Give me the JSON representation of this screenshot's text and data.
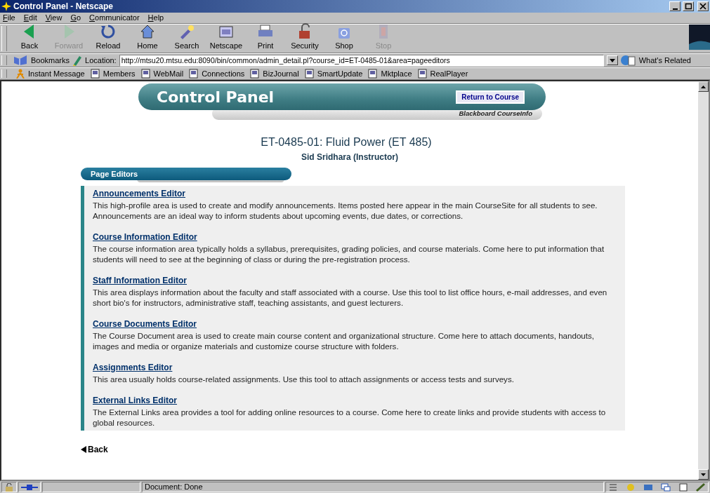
{
  "window": {
    "title": "Control Panel - Netscape"
  },
  "menu": [
    "File",
    "Edit",
    "View",
    "Go",
    "Communicator",
    "Help"
  ],
  "toolbar": [
    {
      "label": "Back",
      "disabled": false
    },
    {
      "label": "Forward",
      "disabled": true
    },
    {
      "label": "Reload",
      "disabled": false
    },
    {
      "label": "Home",
      "disabled": false
    },
    {
      "label": "Search",
      "disabled": false
    },
    {
      "label": "Netscape",
      "disabled": false
    },
    {
      "label": "Print",
      "disabled": false
    },
    {
      "label": "Security",
      "disabled": false
    },
    {
      "label": "Shop",
      "disabled": false
    },
    {
      "label": "Stop",
      "disabled": true
    }
  ],
  "location_bar": {
    "bookmarks": "Bookmarks",
    "label": "Location:",
    "url": "http://mtsu20.mtsu.edu:8090/bin/common/admin_detail.pl?course_id=ET-0485-01&area=pageeditors",
    "related": "What's Related"
  },
  "personal_bar": [
    "Instant Message",
    "Members",
    "WebMail",
    "Connections",
    "BizJournal",
    "SmartUpdate",
    "Mktplace",
    "RealPlayer"
  ],
  "page": {
    "banner_title": "Control Panel",
    "return_button": "Return to Course",
    "brand": "Blackboard CourseInfo",
    "course_title": "ET-0485-01: Fluid Power (ET 485)",
    "instructor": "Sid Sridhara (Instructor)",
    "section_title": "Page Editors",
    "editors": [
      {
        "title": "Announcements Editor",
        "description": "This high-profile area is used to create and modify announcements. Items posted here appear in the main CourseSite for all students to see. Announcements are an ideal way to inform students about upcoming events, due dates, or corrections."
      },
      {
        "title": "Course Information Editor",
        "description": "The course information area typically holds a syllabus, prerequisites, grading policies, and course materials. Come here to put information that students will need to see at the beginning of class or during the pre-registration process."
      },
      {
        "title": "Staff Information Editor",
        "description": "This area displays information about the faculty and staff associated with a course. Use this tool to list office hours, e-mail addresses, and even short bio's for instructors, administrative staff, teaching assistants, and guest lecturers."
      },
      {
        "title": "Course Documents Editor",
        "description": "The Course Document area is used to create main course content and organizational structure. Come here to attach documents, handouts, images and media or organize materials and customize course structure with folders."
      },
      {
        "title": "Assignments Editor",
        "description": "This area usually holds course-related assignments. Use this tool to attach assignments or access tests and surveys."
      },
      {
        "title": "External Links Editor",
        "description": "The External Links area provides a tool for adding online resources to a course. Come here to create links and provide students with access to global resources."
      }
    ],
    "back_link": "Back"
  },
  "status_bar": {
    "text": "Document: Done"
  }
}
